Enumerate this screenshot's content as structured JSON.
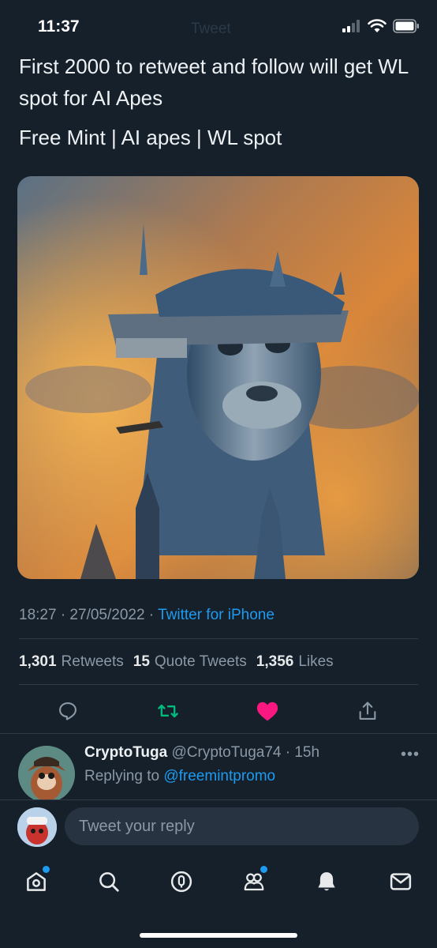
{
  "status_bar": {
    "time": "11:37",
    "ghost_title": "Tweet"
  },
  "tweet": {
    "line1": "First 2000 to retweet and follow will get WL spot for AI Apes",
    "line2": "Free Mint | AI apes | WL spot",
    "timestamp": "18:27 · 27/05/2022 · ",
    "source": "Twitter for iPhone"
  },
  "stats": {
    "retweets_count": "1,301",
    "retweets_label": "Retweets",
    "quotes_count": "15",
    "quotes_label": "Quote Tweets",
    "likes_count": "1,356",
    "likes_label": "Likes"
  },
  "actions": [
    {
      "icon": "reply-icon"
    },
    {
      "icon": "retweet-icon",
      "color": "#00ba7c"
    },
    {
      "icon": "like-icon",
      "color": "#f91880",
      "liked": true
    },
    {
      "icon": "share-icon"
    }
  ],
  "reply": {
    "name": "CryptoTuga",
    "handle_time": " @CryptoTuga74 · 15h",
    "replying_prefix": "Replying to ",
    "replying_to": "@freemintpromo",
    "more": "•••"
  },
  "compose": {
    "placeholder": "Tweet your reply"
  },
  "tabbar": [
    {
      "icon": "home-icon",
      "notification_dot": true
    },
    {
      "icon": "search-icon"
    },
    {
      "icon": "spaces-icon"
    },
    {
      "icon": "communities-icon",
      "notification_dot": true
    },
    {
      "icon": "notifications-icon",
      "active": true
    },
    {
      "icon": "messages-icon"
    }
  ],
  "colors": {
    "background": "#15202b",
    "accent": "#1d9bf0",
    "muted": "#8b98a5"
  }
}
